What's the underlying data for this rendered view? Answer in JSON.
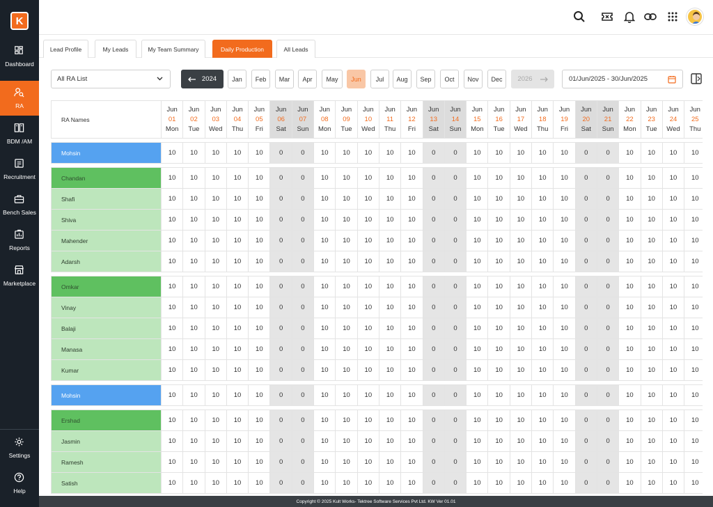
{
  "brand": {
    "logo_letter": "K",
    "accent": "#f26b1d"
  },
  "sidebar": {
    "items": [
      {
        "label": "Dashboard",
        "icon": "dashboard-icon",
        "active": false
      },
      {
        "label": "RA",
        "icon": "user-search-icon",
        "active": true
      },
      {
        "label": "BDM /AM",
        "icon": "columns-icon",
        "active": false
      },
      {
        "label": "Recruitment",
        "icon": "clipboard-icon",
        "active": false
      },
      {
        "label": "Bench Sales",
        "icon": "briefcase-icon",
        "active": false
      },
      {
        "label": "Reports",
        "icon": "report-icon",
        "active": false
      },
      {
        "label": "Marketplace",
        "icon": "store-icon",
        "active": false
      }
    ],
    "bottom_items": [
      {
        "label": "Settings",
        "icon": "gear-icon"
      },
      {
        "label": "Help",
        "icon": "help-icon"
      }
    ]
  },
  "topbar": {
    "icons": [
      "search-icon",
      "ticket-icon",
      "bell-icon",
      "link-icon",
      "apps-grid-icon",
      "avatar"
    ]
  },
  "tabs": [
    {
      "label": "Lead Profile",
      "active": false
    },
    {
      "label": "My Leads",
      "active": false
    },
    {
      "label": "My Team Summary",
      "active": false
    },
    {
      "label": "Daily Production",
      "active": true
    },
    {
      "label": "All Leads",
      "active": false
    }
  ],
  "filters": {
    "ra_select": "All RA List",
    "prev_year": "2024",
    "next_year": "2026",
    "months": [
      "Jan",
      "Feb",
      "Mar",
      "Apr",
      "May",
      "Jun",
      "Jul",
      "Aug",
      "Sep",
      "Oct",
      "Nov",
      "Dec"
    ],
    "active_month": "Jun",
    "date_range": "01/Jun/2025 - 30/Jun/2025"
  },
  "table": {
    "name_header": "RA Names",
    "month_label": "Jun",
    "days": [
      {
        "num": "01",
        "dow": "Mon",
        "weekend": false
      },
      {
        "num": "02",
        "dow": "Tue",
        "weekend": false
      },
      {
        "num": "03",
        "dow": "Wed",
        "weekend": false
      },
      {
        "num": "04",
        "dow": "Thu",
        "weekend": false
      },
      {
        "num": "05",
        "dow": "Fri",
        "weekend": false
      },
      {
        "num": "06",
        "dow": "Sat",
        "weekend": true
      },
      {
        "num": "07",
        "dow": "Sun",
        "weekend": true
      },
      {
        "num": "08",
        "dow": "Mon",
        "weekend": false
      },
      {
        "num": "09",
        "dow": "Tue",
        "weekend": false
      },
      {
        "num": "10",
        "dow": "Wed",
        "weekend": false
      },
      {
        "num": "11",
        "dow": "Thu",
        "weekend": false
      },
      {
        "num": "12",
        "dow": "Fri",
        "weekend": false
      },
      {
        "num": "13",
        "dow": "Sat",
        "weekend": true
      },
      {
        "num": "14",
        "dow": "Sun",
        "weekend": true
      },
      {
        "num": "15",
        "dow": "Mon",
        "weekend": false
      },
      {
        "num": "16",
        "dow": "Tue",
        "weekend": false
      },
      {
        "num": "17",
        "dow": "Wed",
        "weekend": false
      },
      {
        "num": "18",
        "dow": "Thu",
        "weekend": false
      },
      {
        "num": "19",
        "dow": "Fri",
        "weekend": false
      },
      {
        "num": "20",
        "dow": "Sat",
        "weekend": true
      },
      {
        "num": "21",
        "dow": "Sun",
        "weekend": true
      },
      {
        "num": "22",
        "dow": "Mon",
        "weekend": false
      },
      {
        "num": "23",
        "dow": "Tue",
        "weekend": false
      },
      {
        "num": "24",
        "dow": "Wed",
        "weekend": false
      },
      {
        "num": "25",
        "dow": "Thu",
        "weekend": false
      }
    ],
    "weekday_value": "10",
    "weekend_value": "0",
    "groups": [
      {
        "rows": [
          {
            "name": "Mohsin",
            "kind": "blue"
          }
        ]
      },
      {
        "rows": [
          {
            "name": "Chandan",
            "kind": "green-lead"
          },
          {
            "name": "Shafi",
            "kind": "green-member"
          },
          {
            "name": "Shiva",
            "kind": "green-member"
          },
          {
            "name": "Mahender",
            "kind": "green-member"
          },
          {
            "name": "Adarsh",
            "kind": "green-member"
          }
        ]
      },
      {
        "rows": [
          {
            "name": "Omkar",
            "kind": "green-lead"
          },
          {
            "name": "Vinay",
            "kind": "green-member"
          },
          {
            "name": "Balaji",
            "kind": "green-member"
          },
          {
            "name": "Manasa",
            "kind": "green-member"
          },
          {
            "name": "Kumar",
            "kind": "green-member"
          }
        ]
      },
      {
        "rows": [
          {
            "name": "Mohsin",
            "kind": "blue"
          }
        ]
      },
      {
        "rows": [
          {
            "name": "Ershad",
            "kind": "green-lead"
          },
          {
            "name": "Jasmin",
            "kind": "green-member"
          },
          {
            "name": "Ramesh",
            "kind": "green-member"
          },
          {
            "name": "Satish",
            "kind": "green-member"
          }
        ]
      }
    ]
  },
  "footer": {
    "text": "Copyright © 2025 Kult Works- Tektree Software Services Pvt Ltd.  KW Ver 01.01"
  }
}
